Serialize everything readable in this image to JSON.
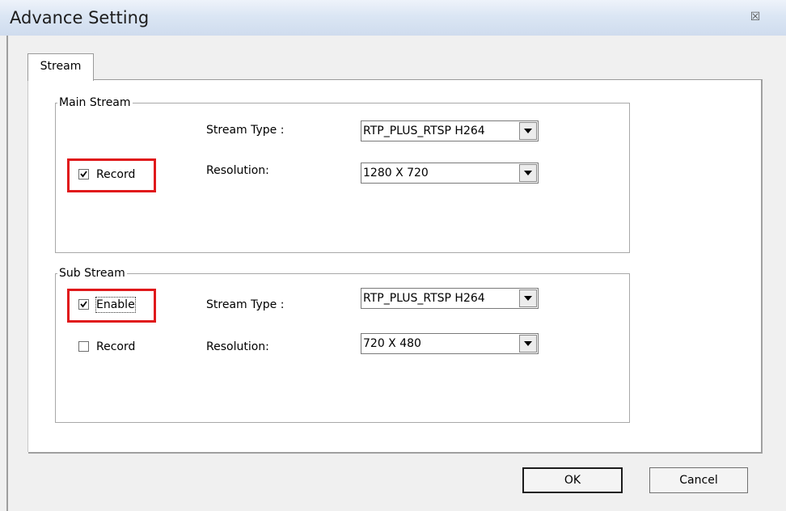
{
  "window": {
    "title": "Advance Setting",
    "close_glyph": "☒"
  },
  "tabs": [
    {
      "label": "Stream",
      "selected": true
    }
  ],
  "main_stream": {
    "group_label": "Main Stream",
    "stream_type_label": "Stream Type :",
    "stream_type_value": "RTP_PLUS_RTSP H264",
    "resolution_label": "Resolution:",
    "resolution_value": "1280 X 720",
    "record_label": "Record",
    "record_checked": true
  },
  "sub_stream": {
    "group_label": "Sub Stream",
    "enable_label": "Enable",
    "enable_checked": true,
    "record_label": "Record",
    "record_checked": false,
    "stream_type_label": "Stream Type :",
    "stream_type_value": "RTP_PLUS_RTSP H264",
    "resolution_label": "Resolution:",
    "resolution_value": "720 X 480"
  },
  "buttons": {
    "ok_label": "OK",
    "cancel_label": "Cancel"
  },
  "colors": {
    "highlight": "#e0191b",
    "titlebar": "#dbe6f4",
    "dialog_bg": "#f0f0f0"
  }
}
